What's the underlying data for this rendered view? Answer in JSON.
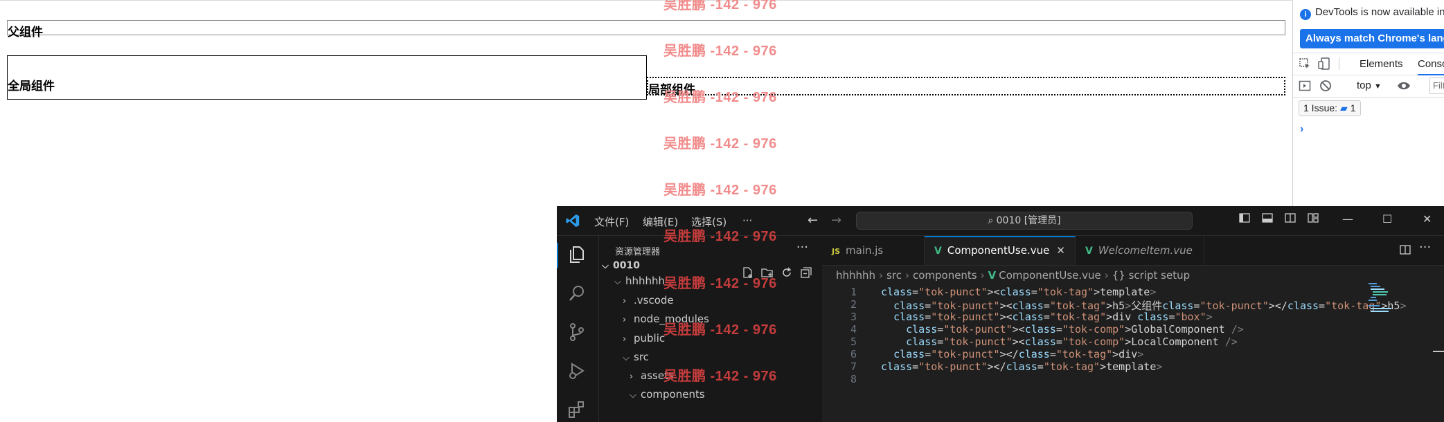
{
  "page": {
    "parent_title": "父组件",
    "global_title": "全局组件",
    "local_title": "局部组件"
  },
  "watermark": {
    "text": "吴胜鹏 -142 - 976",
    "colors": [
      "#f28b8b",
      "#f28b8b",
      "#f28b8b",
      "#f28b8b",
      "#f28b8b",
      "#c43c3c",
      "#c43c3c",
      "#c43c3c",
      "#c43c3c"
    ]
  },
  "devtools": {
    "notice": "DevTools is now available in",
    "match_button": "Always match Chrome's language",
    "tabs": [
      "Elements",
      "Console"
    ],
    "context_select": "top",
    "filter_placeholder": "Filter",
    "issues_label": "1 Issue:",
    "issues_count": "1",
    "prompt": "›"
  },
  "vscode": {
    "menu": [
      "文件(F)",
      "编辑(E)",
      "选择(S)",
      "···"
    ],
    "command_center": "0010 [管理员]",
    "sidebar": {
      "title": "资源管理器",
      "tree": [
        {
          "label": "0010",
          "expanded": true
        },
        {
          "label": "hhhhhh",
          "expanded": true
        },
        {
          "label": ".vscode",
          "expanded": false
        },
        {
          "label": "node_modules",
          "expanded": false
        },
        {
          "label": "public",
          "expanded": false
        },
        {
          "label": "src",
          "expanded": true
        },
        {
          "label": "assets",
          "expanded": false
        },
        {
          "label": "components",
          "expanded": true
        }
      ]
    },
    "tabs": [
      {
        "label": "main.js",
        "icon": "js"
      },
      {
        "label": "ComponentUse.vue",
        "icon": "vue",
        "active": true
      },
      {
        "label": "WelcomeItem.vue",
        "icon": "vue",
        "italic": true
      }
    ],
    "breadcrumb": [
      "hhhhhh",
      "src",
      "components",
      "ComponentUse.vue",
      "{} script setup"
    ],
    "code_lines": [
      {
        "num": "1",
        "text": "<template>"
      },
      {
        "num": "2",
        "text": "  <h5>父组件</h5>"
      },
      {
        "num": "3",
        "text": "  <div class=\"box\">"
      },
      {
        "num": "4",
        "text": "    <GlobalComponent />"
      },
      {
        "num": "5",
        "text": "    <LocalComponent />"
      },
      {
        "num": "6",
        "text": "  </div>"
      },
      {
        "num": "7",
        "text": "</template>"
      },
      {
        "num": "8",
        "text": ""
      }
    ]
  }
}
